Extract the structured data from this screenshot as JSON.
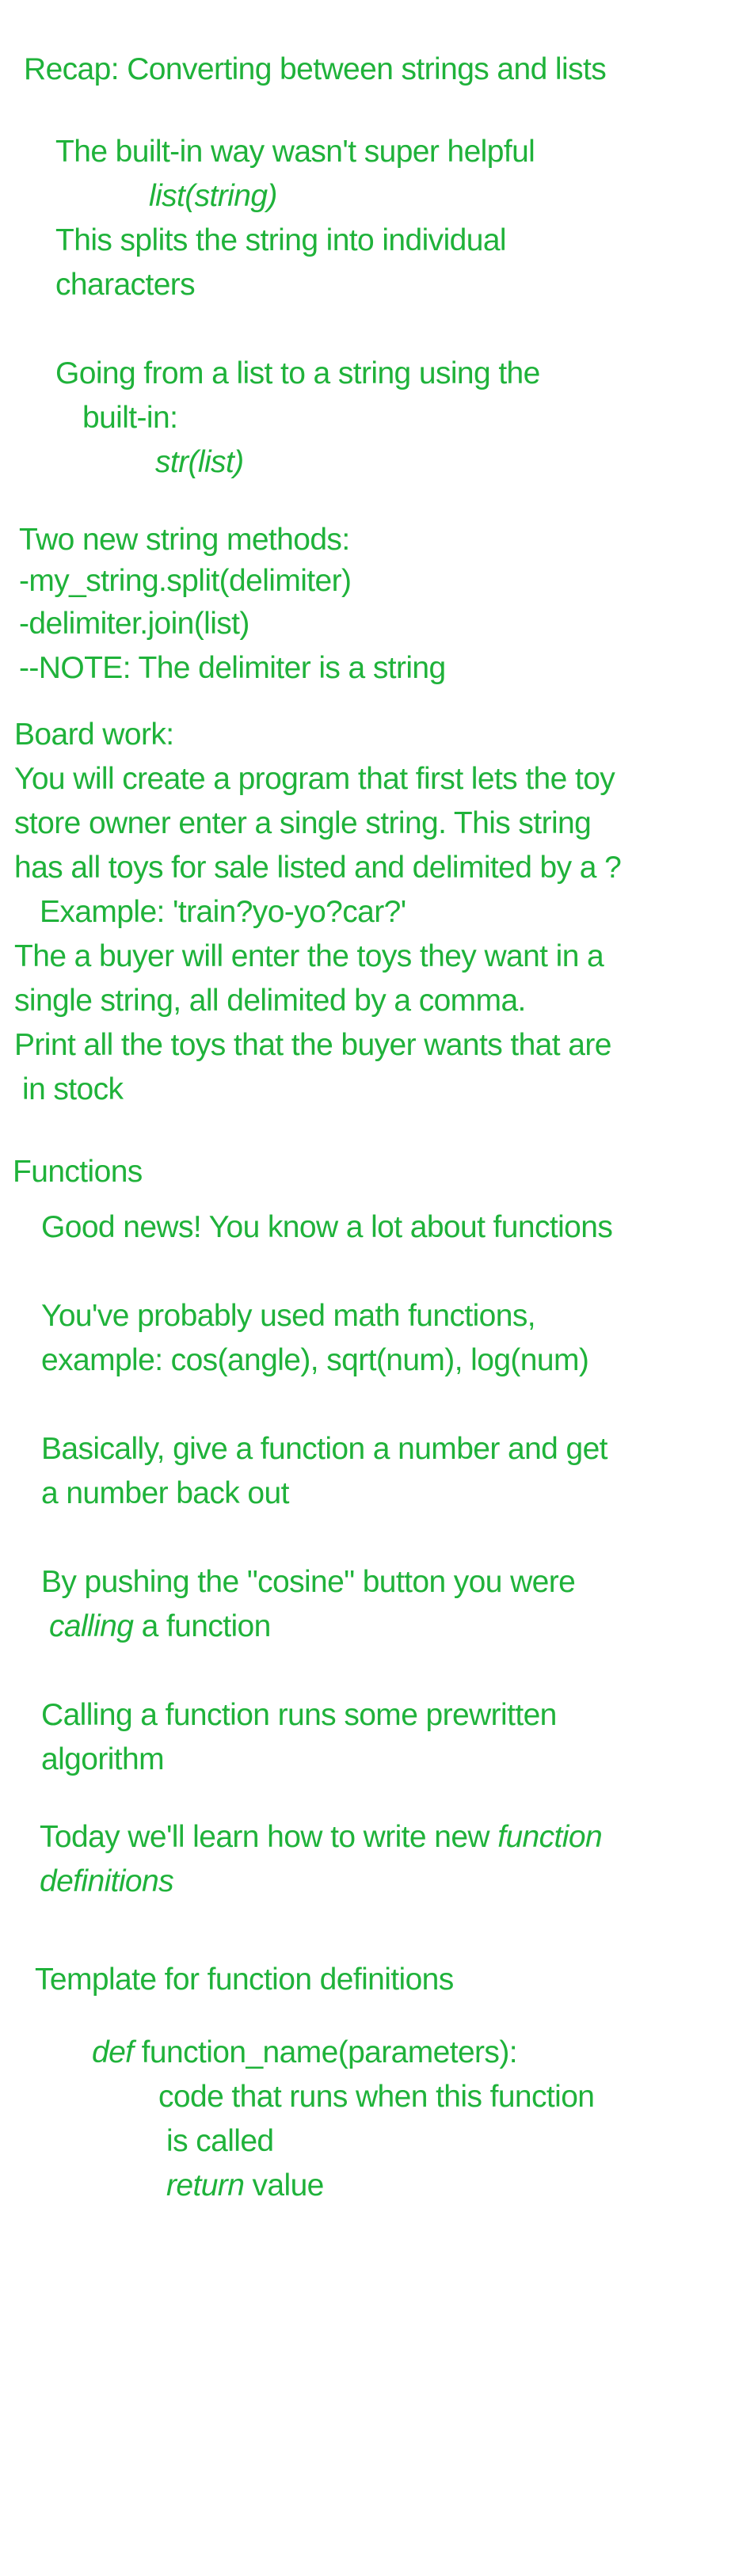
{
  "ink_color": "#1fb23a",
  "recap": {
    "title": "Recap: Converting between strings and lists",
    "line1": "The built-in way wasn't super helpful",
    "code1": "list(string)",
    "line2": "This splits the string into individual",
    "line3": "characters",
    "line4": "Going from a list to a string using the",
    "line5": "built-in:",
    "code2": "str(list)"
  },
  "string_methods": {
    "title": "Two new string methods:",
    "item1": "-my_string.split(delimiter)",
    "item2": "-delimiter.join(list)",
    "note": "--NOTE: The delimiter is a string"
  },
  "board_work": {
    "title": "Board work:",
    "line1": "You will create a program that first lets the toy",
    "line2": "store owner enter a single string. This string",
    "line3": "has all toys for sale listed and delimited by a ?",
    "example": "Example: 'train?yo-yo?car?'",
    "line4": "The a buyer will enter the toys they want in a",
    "line5": "single string, all delimited by a comma.",
    "line6": "Print all the toys that the buyer wants that are",
    "line7": "in stock"
  },
  "functions": {
    "title": "Functions",
    "good_news": "Good news! You know a lot about functions",
    "math1": "You've probably used math functions,",
    "math2": "example: cos(angle), sqrt(num), log(num)",
    "basic1": "Basically, give a function a number and get",
    "basic2": "a number back out",
    "cosine1": "By pushing the \"cosine\" button you were",
    "cosine_italic": "calling",
    "cosine_rest": " a function",
    "calling1": "Calling a function runs some prewritten",
    "calling2": "algorithm",
    "today_plain": "Today we'll learn how to write new ",
    "today_italic": "function",
    "today2": "definitions"
  },
  "template": {
    "title": "Template for function definitions",
    "def_kw": "def",
    "def_rest": " function_name(parameters):",
    "body1": "code that runs when this function",
    "body2": "is called",
    "return_kw": "return",
    "return_rest": " value"
  }
}
